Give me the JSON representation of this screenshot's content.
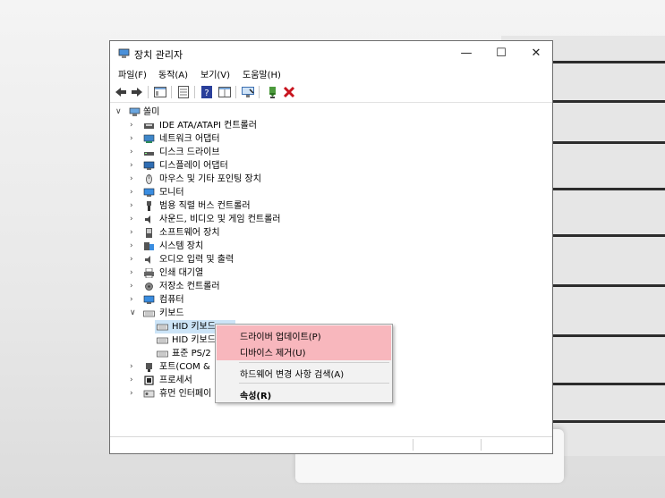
{
  "window": {
    "title": "장치 관리자",
    "minimize": "—",
    "maximize": "☐",
    "close": "✕"
  },
  "menu": [
    "파일(F)",
    "동작(A)",
    "보기(V)",
    "도움말(H)"
  ],
  "tree": {
    "root": "쏠미",
    "categories": [
      "IDE ATA/ATAPI 컨트롤러",
      "네트워크 어댑터",
      "디스크 드라이브",
      "디스플레이 어댑터",
      "마우스 및 기타 포인팅 장치",
      "모니터",
      "범용 직렬 버스 컨트롤러",
      "사운드, 비디오 및 게임 컨트롤러",
      "소프트웨어 장치",
      "시스템 장치",
      "오디오 입력 및 출력",
      "인쇄 대기열",
      "저장소 컨트롤러",
      "컴퓨터",
      "키보드"
    ],
    "keyboard_children": [
      "HID 키보드",
      "HID 키보드",
      "표준 PS/2"
    ],
    "after": [
      "포트(COM &",
      "프로세서",
      "휴먼 인터페이"
    ]
  },
  "context_menu": {
    "update_driver": "드라이버 업데이트(P)",
    "uninstall_device": "디바이스 제거(U)",
    "scan_hardware": "하드웨어 변경 사항 검색(A)",
    "properties": "속성(R)",
    "highlight_color": "#f8b7bd"
  }
}
